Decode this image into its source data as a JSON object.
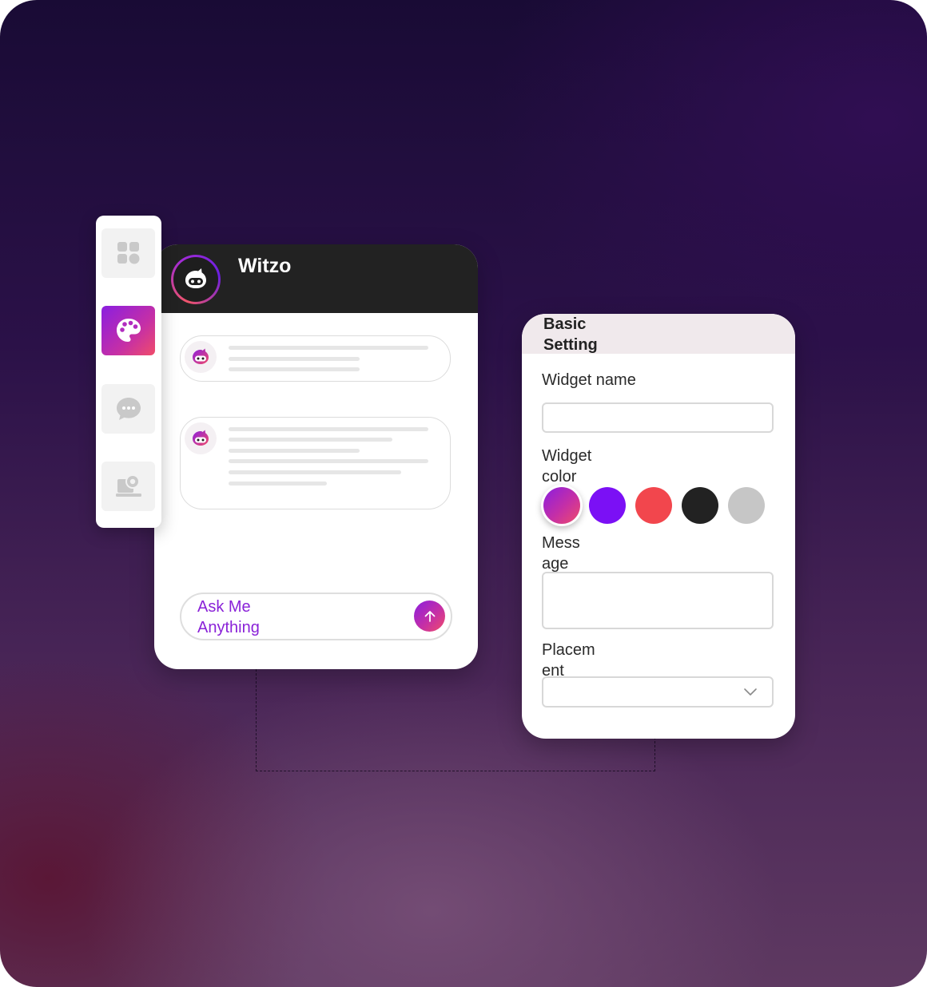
{
  "chat": {
    "title": "Witzo",
    "input_placeholder": "Ask Me Anything"
  },
  "sidebar": {
    "items": [
      {
        "icon": "grid-icon",
        "active": false
      },
      {
        "icon": "palette-icon",
        "active": true
      },
      {
        "icon": "chat-bubble-icon",
        "active": false
      },
      {
        "icon": "settings-laptop-icon",
        "active": false
      }
    ]
  },
  "settings": {
    "title": "Basic Setting",
    "widget_name_label": "Widget name",
    "widget_color_label": "Widget color",
    "message_label": "Message",
    "placement_label": "Placement",
    "colors": [
      "gradient-purple-red",
      "#7b10f5",
      "#f2464d",
      "#222222",
      "#c6c6c6"
    ]
  },
  "colors": {
    "accent_purple": "#8a22d8",
    "accent_pink": "#f04c6a",
    "header_dark": "#222222"
  }
}
